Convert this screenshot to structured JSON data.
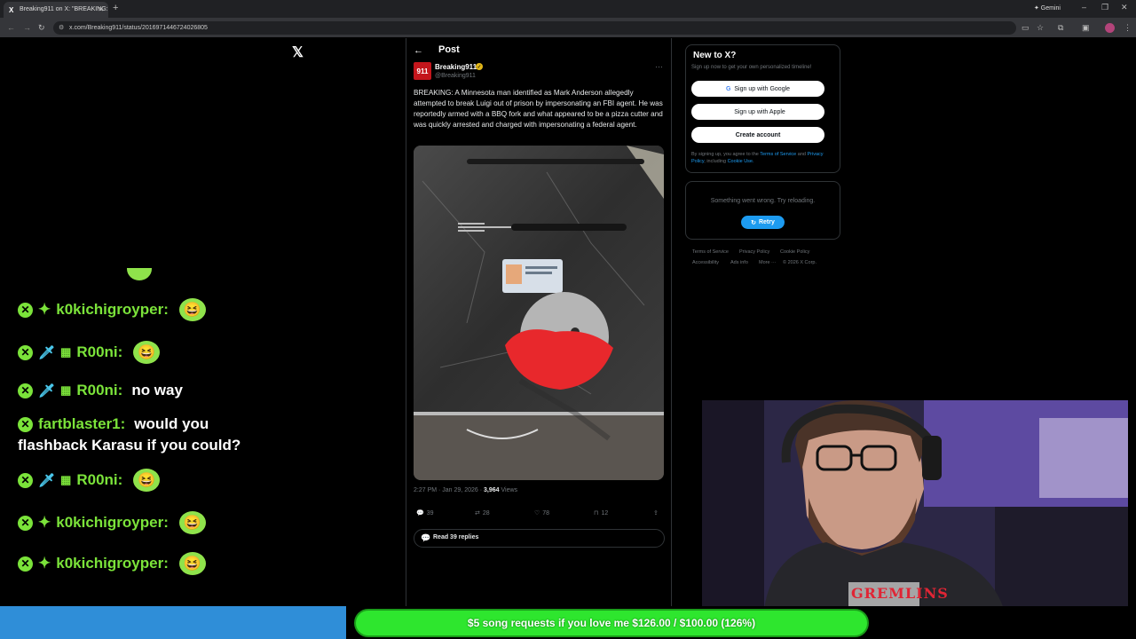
{
  "browser": {
    "tab_title": "Breaking911 on X: \"BREAKING:",
    "tab_close": "✕",
    "new_tab": "+",
    "gemini_label": "✦ Gemini",
    "url": "x.com/Breaking911/status/2016971446724026805"
  },
  "x": {
    "logo": "𝕏",
    "back_arrow": "←",
    "post_heading": "Post",
    "author_name": "Breaking911",
    "author_handle": "@Breaking911",
    "avatar_text": "911",
    "more": "···",
    "text": "BREAKING: A Minnesota man identified as Mark Anderson allegedly attempted to break Luigi out of prison by impersonating an FBI agent. He was reportedly armed with a BBQ fork and what appeared to be a pizza cutter and was quickly arrested and charged with impersonating a federal agent.",
    "time": "2:27 PM · Jan 29, 2026 · ",
    "views": "3,964",
    "views_label": " Views",
    "actions": {
      "replies": "39",
      "reposts": "28",
      "likes": "78",
      "bookmarks": "12"
    },
    "read_replies": "Read 39 replies"
  },
  "sidebar": {
    "title": "New to X?",
    "subtitle": "Sign up now to get your own personalized timeline!",
    "google": "Sign up with Google",
    "apple": "Sign up with Apple",
    "create": "Create account",
    "terms_pre": "By signing up, you agree to the ",
    "terms_tos": "Terms of Service",
    "terms_and": " and",
    "terms_privacy": "Privacy Policy",
    "terms_inc": ", including ",
    "terms_cookie": "Cookie Use.",
    "error": "Something went wrong. Try reloading.",
    "retry": "Retry",
    "footer_links": [
      "Terms of Service",
      "Privacy Policy",
      "Cookie Policy",
      "Accessibility",
      "Ads info",
      "More ···",
      "© 2026 X Corp."
    ]
  },
  "chat": [
    {
      "user": "k0kichigroyper:",
      "msg": "",
      "emote": true
    },
    {
      "user": "R00ni:",
      "msg": "",
      "emote": true
    },
    {
      "user": "R00ni:",
      "msg": "no way",
      "emote": false
    },
    {
      "user": "fartblaster1:",
      "msg": "would you",
      "cont": "flashback Karasu if you could?",
      "emote": false
    },
    {
      "user": "R00ni:",
      "msg": "",
      "emote": true
    },
    {
      "user": "k0kichigroyper:",
      "msg": "",
      "emote": true
    },
    {
      "user": "k0kichigroyper:",
      "msg": "",
      "emote": true
    }
  ],
  "stream": {
    "goal_text": "$5 song requests if you love me $126.00 / $100.00 (126%)",
    "shirt_text": "GREMLINS"
  },
  "colors": {
    "accent": "#1d9bf0",
    "chat_green": "#7be33a",
    "goal_green": "#2ee62e",
    "bottom_blue": "#2f8ed8"
  }
}
